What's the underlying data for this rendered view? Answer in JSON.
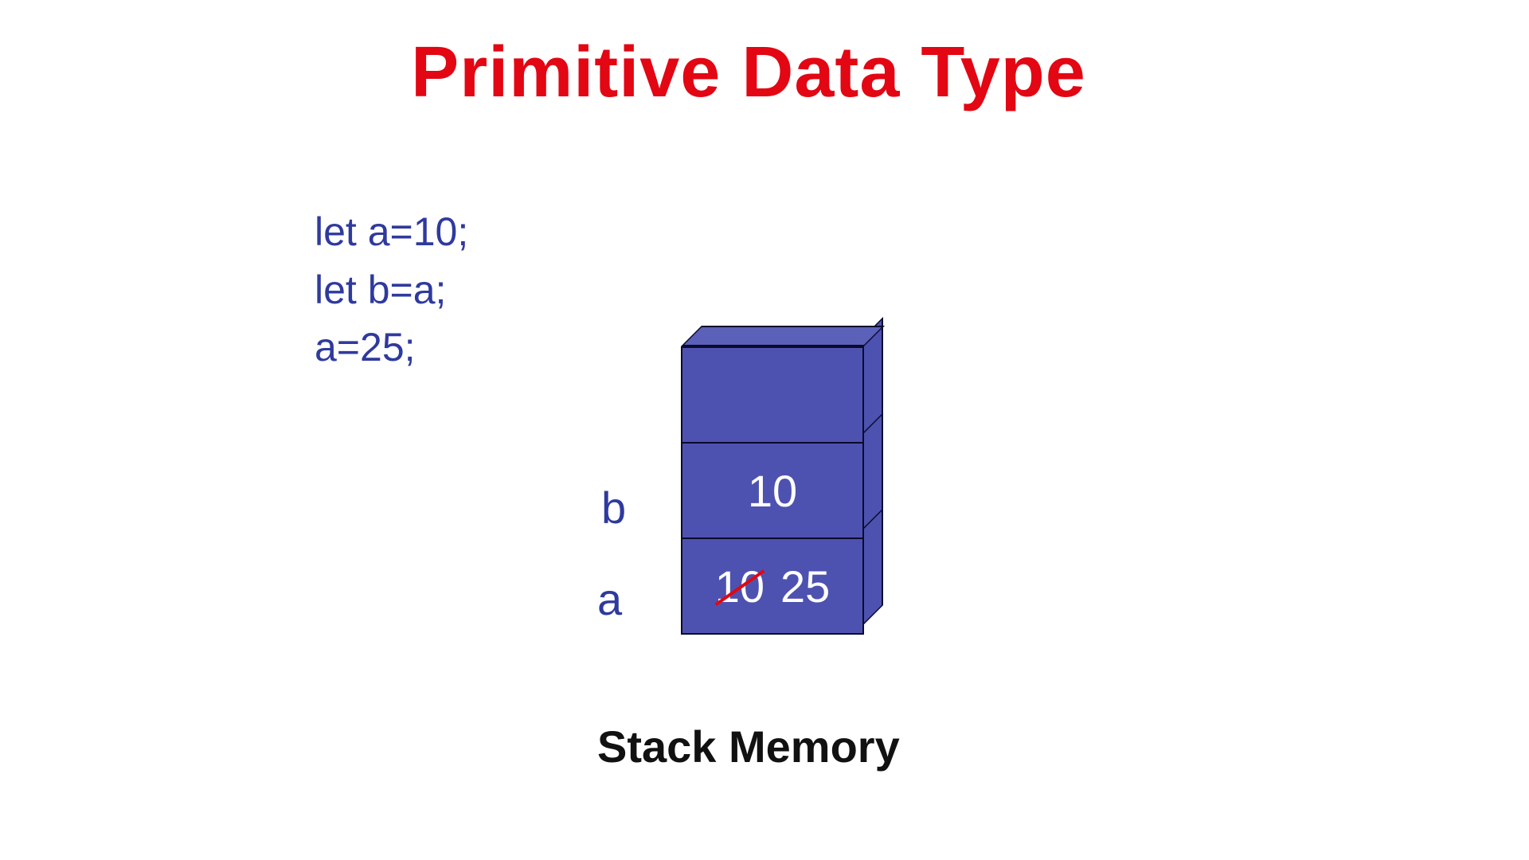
{
  "title": "Primitive Data Type",
  "code": {
    "line1": "let a=10;",
    "line2": "let b=a;",
    "line3": "a=25;"
  },
  "stack": {
    "labels": {
      "b": "b",
      "a": "a"
    },
    "values": {
      "b": "10",
      "a_old": "10",
      "a_new": "25"
    },
    "caption": "Stack Memory"
  },
  "colors": {
    "title": "#e30613",
    "code": "#2f3a9e",
    "cube": "#4d52b0",
    "strike": "#e30613"
  }
}
